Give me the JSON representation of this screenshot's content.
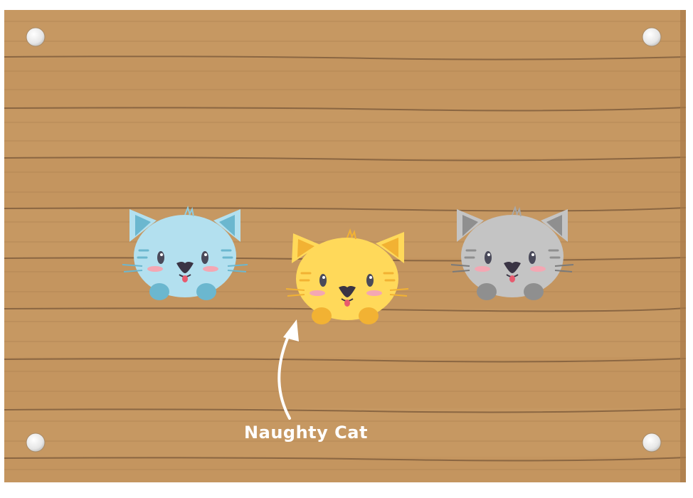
{
  "scene": {
    "caption": "Naughty Cat",
    "cats": [
      {
        "name": "blue-cat",
        "color": "#b3e0ef",
        "accent": "#6bb7cf"
      },
      {
        "name": "yellow-cat",
        "color": "#ffd95a",
        "accent": "#f2b233"
      },
      {
        "name": "gray-cat",
        "color": "#c4c4c4",
        "accent": "#8f8f8f"
      }
    ],
    "colors": {
      "wood": "#c4955f",
      "wood_dark": "#8a6642",
      "nail": "#e8e8e8"
    }
  }
}
